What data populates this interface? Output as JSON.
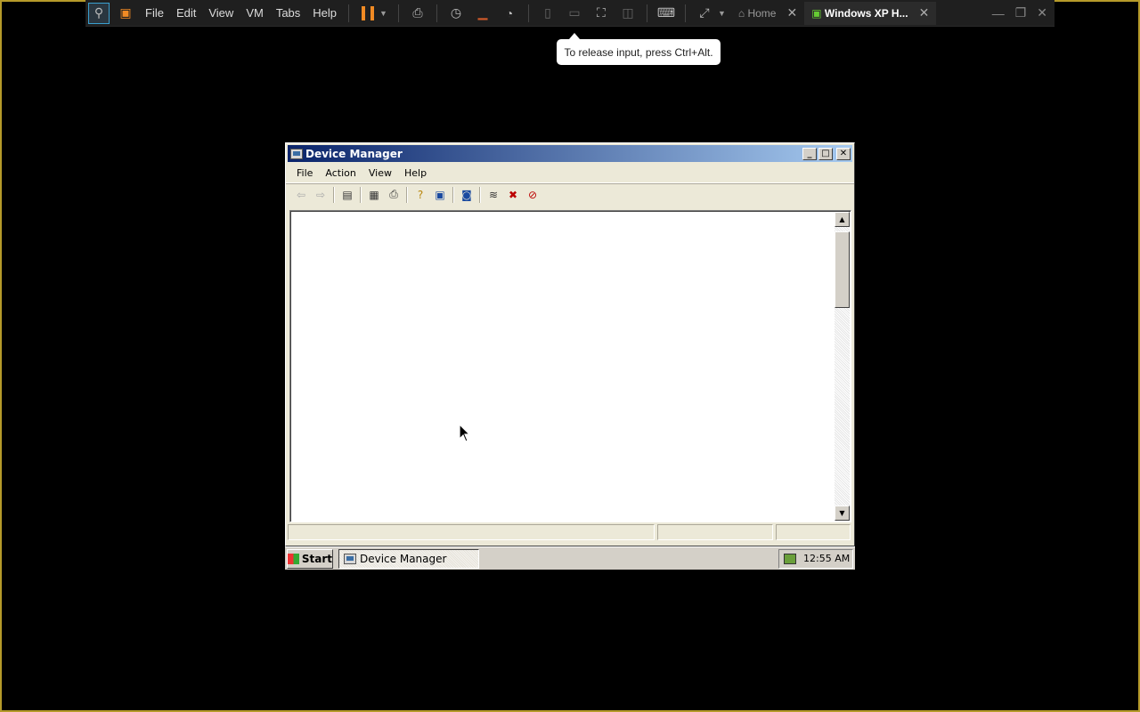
{
  "vmware": {
    "menu": [
      "File",
      "Edit",
      "View",
      "VM",
      "Tabs",
      "Help"
    ],
    "tabs": [
      {
        "label": "Home",
        "active": false
      },
      {
        "label": "Windows XP H...",
        "active": true
      }
    ],
    "accent": "#f08a24"
  },
  "tooltip": "To release input, press Ctrl+Alt.",
  "window": {
    "title": "Device Manager",
    "menu": [
      "File",
      "Action",
      "View",
      "Help"
    ],
    "icons": [
      "back-icon",
      "forward-icon",
      "show-hide-tree-icon",
      "properties-icon",
      "print-icon",
      "help-icon",
      "view-icon",
      "scan-hardware-icon",
      "update-driver-icon",
      "disable-device-icon",
      "uninstall-device-icon"
    ]
  },
  "taskbar": {
    "start": "Start",
    "task": "Device Manager",
    "clock": "12:55 AM"
  }
}
